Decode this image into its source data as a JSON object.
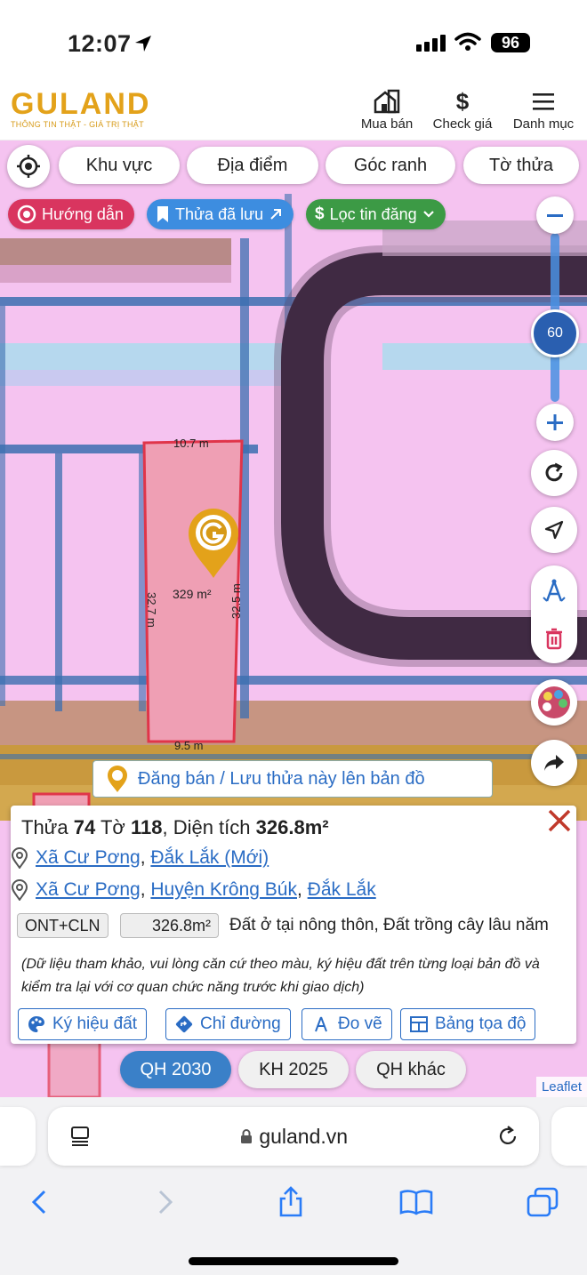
{
  "status_bar": {
    "time": "12:07",
    "battery": "96"
  },
  "header": {
    "logo_text": "GULAND",
    "slogan": "THÔNG TIN THẬT - GIÁ TRỊ THẬT",
    "buttons": [
      {
        "label": "Mua bán",
        "icon": "house-icon"
      },
      {
        "label": "Check giá",
        "icon": "dollar-icon"
      },
      {
        "label": "Danh mục",
        "icon": "menu-icon"
      }
    ]
  },
  "map_toolbar": {
    "filters": [
      "Khu vực",
      "Địa điểm",
      "Góc ranh",
      "Tờ thửa"
    ],
    "guide": "Hướng dẫn",
    "saved": "Thửa đã lưu",
    "filter_posts": "Lọc tin đăng"
  },
  "zoom": {
    "level": "60",
    "level_fraction": 0.5
  },
  "parcel": {
    "top_length": "10.7 m",
    "bottom_length": "9.5 m",
    "left_length": "32.7 m",
    "right_length": "32.5 m",
    "area_label": "329 m²",
    "post_button": "Đăng bán / Lưu thửa này lên bản đồ"
  },
  "info": {
    "title_prefix": "Thửa",
    "parcel_no": "74",
    "sheet_word": "Tờ",
    "sheet_no": "118",
    "area_word": ", Diện tích",
    "area": "326.8m²",
    "address_new": {
      "commune": "Xã Cư Pơng",
      "province": "Đắk Lắk (Mới)"
    },
    "address_old": {
      "commune": "Xã Cư Pơng",
      "district": "Huyện Krông Búk",
      "province": "Đắk Lắk"
    },
    "land_code": "ONT+CLN",
    "land_area": "326.8m²",
    "land_desc": "Đất ở tại nông thôn, Đất trồng cây lâu năm",
    "note": "(Dữ liệu tham khảo, vui lòng căn cứ theo màu, ký hiệu đất trên từng loại bản đồ và kiểm tra lại với cơ quan chức năng trước khi giao dịch)",
    "actions": [
      "Ký hiệu đất",
      "Chỉ đường",
      "Đo vẽ",
      "Bảng tọa độ"
    ]
  },
  "plan_tabs": [
    "QH 2030",
    "KH 2025",
    "QH khác"
  ],
  "attribution": "Leaflet",
  "browser": {
    "url": "guland.vn"
  },
  "colors": {
    "accent_blue": "#2a6cc4",
    "brand_gold": "#e3a21a",
    "guide_red": "#d9355f",
    "filter_green": "#3c9a45",
    "map_pink": "#f5c3f0"
  }
}
